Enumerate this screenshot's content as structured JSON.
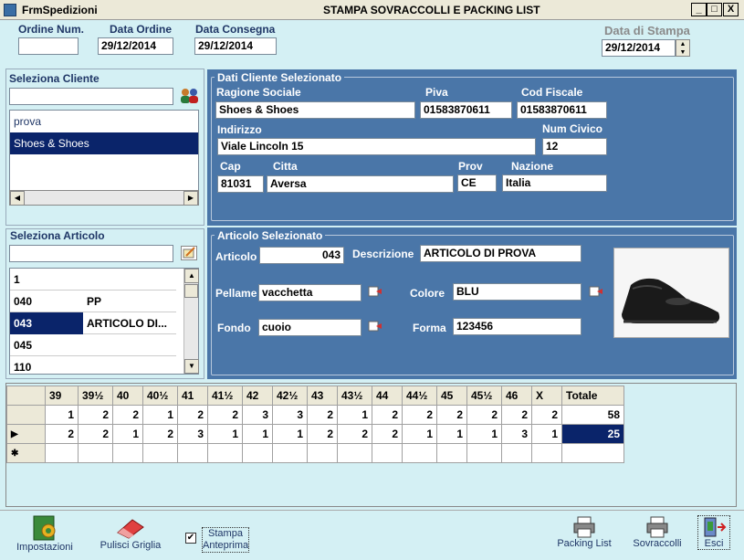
{
  "window": {
    "title": "FrmSpedizioni",
    "subtitle": "STAMPA SOVRACCOLLI E PACKING LIST"
  },
  "header": {
    "ordine_num_label": "Ordine Num.",
    "ordine_num_value": "",
    "data_ordine_label": "Data Ordine",
    "data_ordine_value": "29/12/2014",
    "data_consegna_label": "Data Consegna",
    "data_consegna_value": "29/12/2014",
    "data_stampa_label": "Data di Stampa",
    "data_stampa_value": "29/12/2014"
  },
  "cliente": {
    "section_label": "Seleziona Cliente",
    "search_value": "",
    "items": [
      "prova",
      "Shoes & Shoes"
    ],
    "selected_index": 1
  },
  "dati_cliente": {
    "group_title": "Dati Cliente Selezionato",
    "ragione_label": "Ragione  Sociale",
    "ragione_value": "Shoes & Shoes",
    "piva_label": "Piva",
    "piva_value": "01583870611",
    "codfisc_label": "Cod Fiscale",
    "codfisc_value": "01583870611",
    "indirizzo_label": "Indirizzo",
    "indirizzo_value": "Viale Lincoln 15",
    "civico_label": "Num Civico",
    "civico_value": "12",
    "cap_label": "Cap",
    "cap_value": "81031",
    "citta_label": "Citta",
    "citta_value": "Aversa",
    "prov_label": "Prov",
    "prov_value": "CE",
    "nazione_label": "Nazione",
    "nazione_value": "Italia"
  },
  "articolo_list": {
    "section_label": "Seleziona Articolo",
    "search_value": "",
    "rows": [
      {
        "code": "1",
        "desc": ""
      },
      {
        "code": "040",
        "desc": "PP"
      },
      {
        "code": "043",
        "desc": "ARTICOLO DI..."
      },
      {
        "code": "045",
        "desc": ""
      },
      {
        "code": "110",
        "desc": ""
      }
    ],
    "selected_index": 2
  },
  "articolo_sel": {
    "group_title": "Articolo Selezionato",
    "articolo_label": "Articolo",
    "articolo_value": "043",
    "descrizione_label": "Descrizione",
    "descrizione_value": "ARTICOLO DI PROVA",
    "pellame_label": "Pellame",
    "pellame_value": "vacchetta",
    "colore_label": "Colore",
    "colore_value": "BLU",
    "fondo_label": "Fondo",
    "fondo_value": "cuoio",
    "forma_label": "Forma",
    "forma_value": "123456"
  },
  "grid": {
    "headers": [
      "39",
      "39½",
      "40",
      "40½",
      "41",
      "41½",
      "42",
      "42½",
      "43",
      "43½",
      "44",
      "44½",
      "45",
      "45½",
      "46",
      "X",
      "Totale"
    ],
    "rows": [
      {
        "indicator": "",
        "values": [
          "1",
          "2",
          "2",
          "1",
          "2",
          "2",
          "3",
          "3",
          "2",
          "1",
          "2",
          "2",
          "2",
          "2",
          "2",
          "2",
          "58"
        ]
      },
      {
        "indicator": "▶",
        "values": [
          "2",
          "2",
          "1",
          "2",
          "3",
          "1",
          "1",
          "1",
          "2",
          "2",
          "2",
          "1",
          "1",
          "1",
          "3",
          "1",
          "25"
        ]
      },
      {
        "indicator": "✱",
        "values": [
          "",
          "",
          "",
          "",
          "",
          "",
          "",
          "",
          "",
          "",
          "",
          "",
          "",
          "",
          "",
          "",
          ""
        ]
      }
    ]
  },
  "toolbar": {
    "impostazioni": "Impostazioni",
    "pulisci": "Pulisci Griglia",
    "stampa_anteprima": "Stampa Anteprima",
    "stampa_checked": true,
    "packing": "Packing List",
    "sovraccolli": "Sovraccolli",
    "esci": "Esci"
  }
}
